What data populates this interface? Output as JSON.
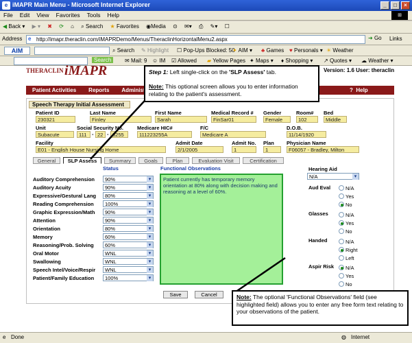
{
  "window": {
    "title": "iMAPR Main Menu - Microsoft Internet Explorer"
  },
  "menu": [
    "File",
    "Edit",
    "View",
    "Favorites",
    "Tools",
    "Help"
  ],
  "toolbar": {
    "back": "Back",
    "search": "Search",
    "favorites": "Favorites",
    "media": "Media"
  },
  "address": {
    "label": "Address",
    "url": "http://imapr.theraclin.com/iMAPRDemo/Menus/TheraclinHorizontalMenu2.aspx",
    "go": "Go",
    "links": "Links"
  },
  "aim_bar": {
    "logo": "AIM",
    "search": "Search",
    "highlight": "Highlight",
    "popups": "Pop-Ups Blocked: 50",
    "aim": "AIM",
    "games": "Games",
    "personals": "Personals",
    "weather": "Weather"
  },
  "aim_bar2": {
    "search": "Search",
    "mail": "Mail: 9",
    "im": "IM",
    "allowed": "Allowed",
    "yellow": "Yellow Pages",
    "maps": "Maps",
    "shopping": "Shopping",
    "quotes": "Quotes",
    "weather": "Weather"
  },
  "header": {
    "logo_text": "THERACLIN",
    "app_name": "iMAPR",
    "version": "Version: 1.6 User: theraclin"
  },
  "nav": {
    "items": [
      "Patient Activities",
      "Reports",
      "Administ"
    ],
    "help": "Help"
  },
  "form": {
    "title": "Speech Therapy Initial Assessment",
    "row1": [
      {
        "label": "Patient ID",
        "value": "230321"
      },
      {
        "label": "Last Name",
        "value": "Finley"
      },
      {
        "label": "First Name",
        "value": "Sarah"
      },
      {
        "label": "Medical Record #",
        "value": "FinSar01"
      },
      {
        "label": "Gender",
        "value": "Female"
      },
      {
        "label": "Room#",
        "value": "102"
      },
      {
        "label": "Bed",
        "value": "Middle"
      }
    ],
    "row2": [
      {
        "label": "Unit",
        "value": "Subacute"
      },
      {
        "label": "Social Security No.",
        "value": ""
      },
      {
        "label": "Medicare HIC#",
        "value": "111223255A"
      },
      {
        "label": "F/C",
        "value": "Medicare A"
      },
      {
        "label": "D.O.B.",
        "value": "11/14/1920"
      }
    ],
    "ssn": [
      "111",
      "22",
      "3255"
    ],
    "row3": [
      {
        "label": "Facility",
        "value": "E01 - English House Nursing Home"
      },
      {
        "label": "Admit Date",
        "value": "2/1/2005"
      },
      {
        "label": "Admit No.",
        "value": "1"
      },
      {
        "label": "Plan",
        "value": "1"
      },
      {
        "label": "Physician Name",
        "value": "F06057 - Bradley, Milton"
      }
    ],
    "tabs": [
      "General",
      "SLP Assess",
      "Summary",
      "Goals",
      "Plan",
      "Evaluation Visit",
      "Certification"
    ],
    "status_header": "Status",
    "obs_header": "Functional Observations",
    "rows": [
      {
        "label": "Auditory Comprehension",
        "value": "90%"
      },
      {
        "label": "Auditory Acuity",
        "value": "90%"
      },
      {
        "label": "Expressive/Gestural Lang",
        "value": "80%"
      },
      {
        "label": "Reading Comprehension",
        "value": "100%"
      },
      {
        "label": "Graphic Expression/Math",
        "value": "90%"
      },
      {
        "label": "Attention",
        "value": "90%"
      },
      {
        "label": "Orientation",
        "value": "80%"
      },
      {
        "label": "Memory",
        "value": "60%"
      },
      {
        "label": "Reasoning/Prob. Solving",
        "value": "60%"
      },
      {
        "label": "Oral Motor",
        "value": "WNL"
      },
      {
        "label": "Swallowing",
        "value": "WNL"
      },
      {
        "label": "Speech Intel/Voice/Respir",
        "value": "WNL"
      },
      {
        "label": "Patient/Family Education",
        "value": "100%"
      }
    ],
    "observations": "Patient currently has temporary memory orientation at 80% along with decision making and reasoning at a level of 60%.",
    "hearing_aid": {
      "label": "Hearing Aid",
      "value": "N/A"
    },
    "radios": [
      {
        "label": "Aud Eval",
        "options": [
          "N/A",
          "Yes",
          "No"
        ],
        "selected": "No"
      },
      {
        "label": "Glasses",
        "options": [
          "N/A",
          "Yes",
          "No"
        ],
        "selected": "Yes"
      },
      {
        "label": "Handed",
        "options": [
          "N/A",
          "Right",
          "Left"
        ],
        "selected": "Right"
      },
      {
        "label": "Aspir Risk",
        "options": [
          "N/A",
          "Yes",
          "No"
        ],
        "selected": "N/A"
      }
    ],
    "save": "Save",
    "cancel": "Cancel"
  },
  "callout1": {
    "step": "Step 1:",
    "text1": " Left single-click on the ",
    "target": "'SLP Assess'",
    "text2": " tab.",
    "note": "Note:",
    "note_text": " This optional screen allows you to enter information relating to the patient's assessment."
  },
  "callout2": {
    "note": "Note:",
    "text": " The optional 'Functional Observations' field (see highlighted field) allows you to enter any free form text relating to your observations of the patient."
  },
  "statusbar": {
    "left": "Done",
    "zone": "Internet"
  }
}
